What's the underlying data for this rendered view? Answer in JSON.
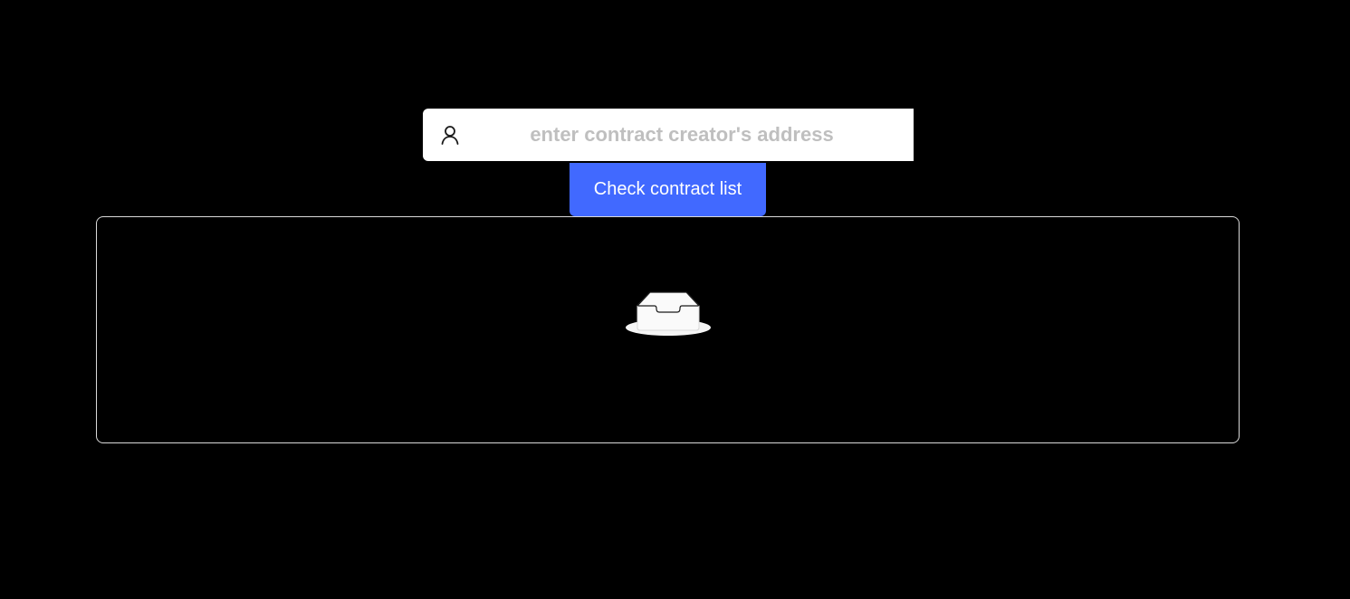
{
  "search": {
    "placeholder": "enter contract creator's address",
    "value": "",
    "icon": "user-icon"
  },
  "actions": {
    "check_label": "Check contract list"
  },
  "contract_list": {
    "items": [],
    "empty_icon": "empty-inbox-icon"
  },
  "colors": {
    "background": "#000000",
    "accent": "#4169ff",
    "panel_border": "#d9d9d9",
    "placeholder": "#bfbfbf"
  }
}
